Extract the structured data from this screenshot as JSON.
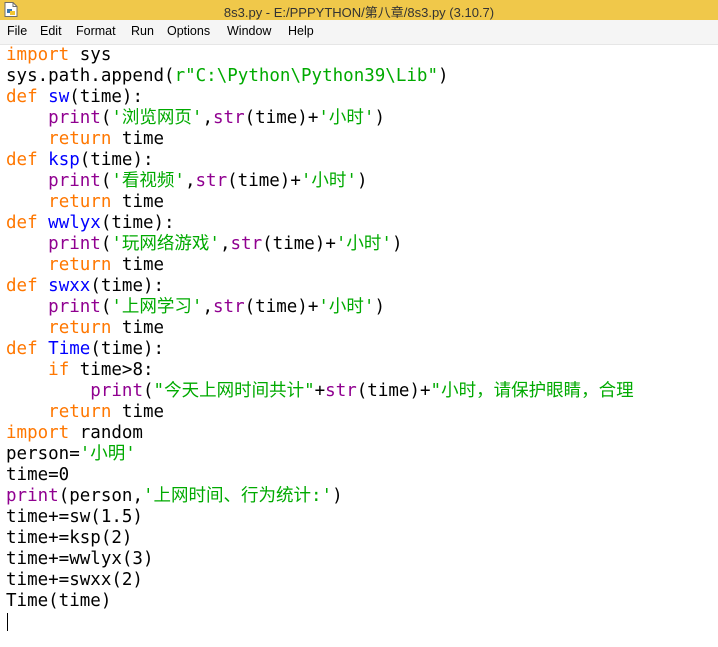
{
  "window": {
    "title": "8s3.py - E:/PPPYTHON/第八章/8s3.py (3.10.7)",
    "title_bar_color": "#f0c84a"
  },
  "menu": {
    "items": [
      "File",
      "Edit",
      "Format",
      "Run",
      "Options",
      "Window",
      "Help"
    ]
  },
  "syntax_colors": {
    "keyword": "#ff7700",
    "builtin": "#900090",
    "string": "#00aa00",
    "definition": "#0000ff",
    "default": "#000000"
  },
  "code": {
    "lines": [
      [
        {
          "t": "kw",
          "s": "import"
        },
        {
          "t": "pl",
          "s": " sys"
        }
      ],
      [
        {
          "t": "pl",
          "s": "sys.path.append("
        },
        {
          "t": "st",
          "s": "r\"C:\\Python\\Python39\\Lib\""
        },
        {
          "t": "pl",
          "s": ")"
        }
      ],
      [
        {
          "t": "kw",
          "s": "def"
        },
        {
          "t": "pl",
          "s": " "
        },
        {
          "t": "df",
          "s": "sw"
        },
        {
          "t": "pl",
          "s": "(time):"
        }
      ],
      [
        {
          "t": "pl",
          "s": "    "
        },
        {
          "t": "bi",
          "s": "print"
        },
        {
          "t": "pl",
          "s": "("
        },
        {
          "t": "st",
          "s": "'浏览网页'"
        },
        {
          "t": "pl",
          "s": ","
        },
        {
          "t": "bi",
          "s": "str"
        },
        {
          "t": "pl",
          "s": "(time)+"
        },
        {
          "t": "st",
          "s": "'小时'"
        },
        {
          "t": "pl",
          "s": ")"
        }
      ],
      [
        {
          "t": "pl",
          "s": "    "
        },
        {
          "t": "kw",
          "s": "return"
        },
        {
          "t": "pl",
          "s": " time"
        }
      ],
      [
        {
          "t": "kw",
          "s": "def"
        },
        {
          "t": "pl",
          "s": " "
        },
        {
          "t": "df",
          "s": "ksp"
        },
        {
          "t": "pl",
          "s": "(time):"
        }
      ],
      [
        {
          "t": "pl",
          "s": "    "
        },
        {
          "t": "bi",
          "s": "print"
        },
        {
          "t": "pl",
          "s": "("
        },
        {
          "t": "st",
          "s": "'看视频'"
        },
        {
          "t": "pl",
          "s": ","
        },
        {
          "t": "bi",
          "s": "str"
        },
        {
          "t": "pl",
          "s": "(time)+"
        },
        {
          "t": "st",
          "s": "'小时'"
        },
        {
          "t": "pl",
          "s": ")"
        }
      ],
      [
        {
          "t": "pl",
          "s": "    "
        },
        {
          "t": "kw",
          "s": "return"
        },
        {
          "t": "pl",
          "s": " time"
        }
      ],
      [
        {
          "t": "kw",
          "s": "def"
        },
        {
          "t": "pl",
          "s": " "
        },
        {
          "t": "df",
          "s": "wwlyx"
        },
        {
          "t": "pl",
          "s": "(time):"
        }
      ],
      [
        {
          "t": "pl",
          "s": "    "
        },
        {
          "t": "bi",
          "s": "print"
        },
        {
          "t": "pl",
          "s": "("
        },
        {
          "t": "st",
          "s": "'玩网络游戏'"
        },
        {
          "t": "pl",
          "s": ","
        },
        {
          "t": "bi",
          "s": "str"
        },
        {
          "t": "pl",
          "s": "(time)+"
        },
        {
          "t": "st",
          "s": "'小时'"
        },
        {
          "t": "pl",
          "s": ")"
        }
      ],
      [
        {
          "t": "pl",
          "s": "    "
        },
        {
          "t": "kw",
          "s": "return"
        },
        {
          "t": "pl",
          "s": " time"
        }
      ],
      [
        {
          "t": "kw",
          "s": "def"
        },
        {
          "t": "pl",
          "s": " "
        },
        {
          "t": "df",
          "s": "swxx"
        },
        {
          "t": "pl",
          "s": "(time):"
        }
      ],
      [
        {
          "t": "pl",
          "s": "    "
        },
        {
          "t": "bi",
          "s": "print"
        },
        {
          "t": "pl",
          "s": "("
        },
        {
          "t": "st",
          "s": "'上网学习'"
        },
        {
          "t": "pl",
          "s": ","
        },
        {
          "t": "bi",
          "s": "str"
        },
        {
          "t": "pl",
          "s": "(time)+"
        },
        {
          "t": "st",
          "s": "'小时'"
        },
        {
          "t": "pl",
          "s": ")"
        }
      ],
      [
        {
          "t": "pl",
          "s": "    "
        },
        {
          "t": "kw",
          "s": "return"
        },
        {
          "t": "pl",
          "s": " time"
        }
      ],
      [
        {
          "t": "kw",
          "s": "def"
        },
        {
          "t": "pl",
          "s": " "
        },
        {
          "t": "df",
          "s": "Time"
        },
        {
          "t": "pl",
          "s": "(time):"
        }
      ],
      [
        {
          "t": "pl",
          "s": "    "
        },
        {
          "t": "kw",
          "s": "if"
        },
        {
          "t": "pl",
          "s": " time>8:"
        }
      ],
      [
        {
          "t": "pl",
          "s": "        "
        },
        {
          "t": "bi",
          "s": "print"
        },
        {
          "t": "pl",
          "s": "("
        },
        {
          "t": "st",
          "s": "\"今天上网时间共计\""
        },
        {
          "t": "pl",
          "s": "+"
        },
        {
          "t": "bi",
          "s": "str"
        },
        {
          "t": "pl",
          "s": "(time)+"
        },
        {
          "t": "st",
          "s": "\"小时，请保护眼睛，合理"
        }
      ],
      [
        {
          "t": "pl",
          "s": "    "
        },
        {
          "t": "kw",
          "s": "return"
        },
        {
          "t": "pl",
          "s": " time"
        }
      ],
      [
        {
          "t": "kw",
          "s": "import"
        },
        {
          "t": "pl",
          "s": " random"
        }
      ],
      [
        {
          "t": "pl",
          "s": "person="
        },
        {
          "t": "st",
          "s": "'小明'"
        }
      ],
      [
        {
          "t": "pl",
          "s": "time=0"
        }
      ],
      [
        {
          "t": "bi",
          "s": "print"
        },
        {
          "t": "pl",
          "s": "(person,"
        },
        {
          "t": "st",
          "s": "'上网时间、行为统计:'"
        },
        {
          "t": "pl",
          "s": ")"
        }
      ],
      [
        {
          "t": "pl",
          "s": "time+=sw(1.5)"
        }
      ],
      [
        {
          "t": "pl",
          "s": "time+=ksp(2)"
        }
      ],
      [
        {
          "t": "pl",
          "s": "time+=wwlyx(3)"
        }
      ],
      [
        {
          "t": "pl",
          "s": "time+=swxx(2)"
        }
      ],
      [
        {
          "t": "pl",
          "s": "Time(time)"
        }
      ]
    ]
  }
}
